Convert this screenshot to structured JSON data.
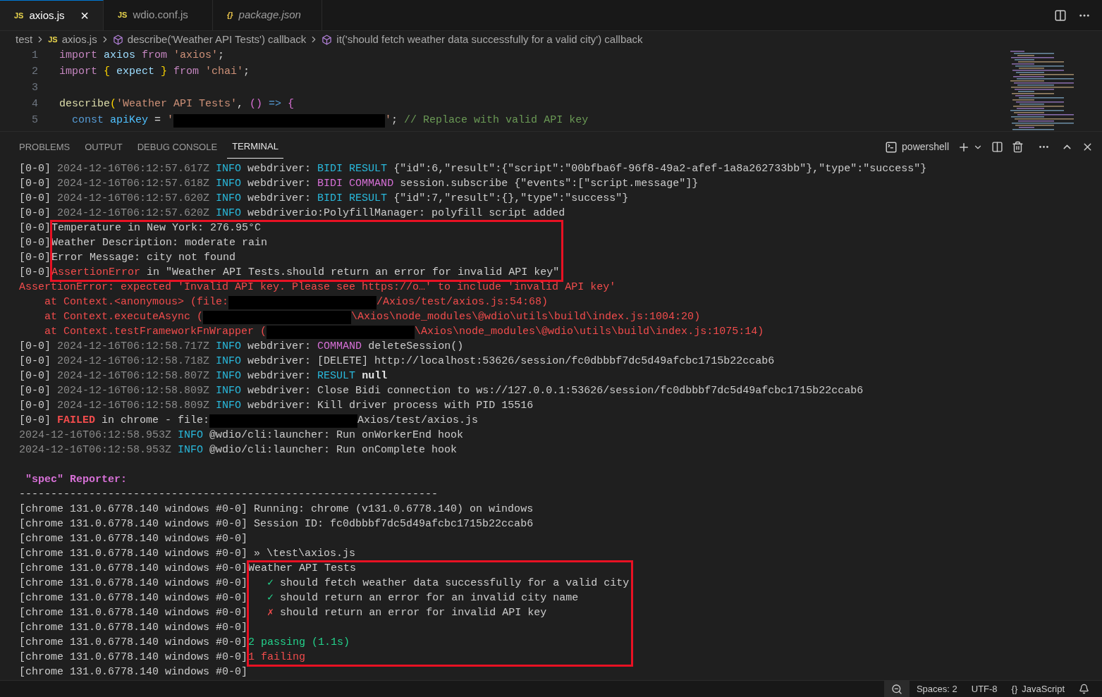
{
  "editor_tabs": [
    {
      "badge": "JS",
      "label": "axios.js",
      "selected": true,
      "preview": false,
      "close": "×"
    },
    {
      "badge": "JS",
      "label": "wdio.conf.js",
      "selected": false,
      "preview": false
    },
    {
      "badge": "{}",
      "label": "package.json",
      "selected": false,
      "preview": true
    }
  ],
  "breadcrumbs": [
    {
      "kind": "folder",
      "label": "test"
    },
    {
      "kind": "file",
      "badge": "JS",
      "label": "axios.js"
    },
    {
      "kind": "symbol",
      "label": "describe('Weather API Tests') callback"
    },
    {
      "kind": "symbol",
      "label": "it('should fetch weather data successfully for a valid city') callback"
    }
  ],
  "code_lines": [
    {
      "number": "1",
      "tokens": [
        {
          "kind": "keyword",
          "text": "import"
        },
        {
          "kind": "variable",
          "text": " axios"
        },
        {
          "kind": "keyword",
          "text": " from"
        },
        {
          "kind": "string",
          "text": " 'axios'"
        },
        {
          "kind": "plain",
          "text": ";"
        }
      ]
    },
    {
      "number": "2",
      "tokens": [
        {
          "kind": "keyword",
          "text": "import"
        },
        {
          "kind": "bracket",
          "text": " {"
        },
        {
          "kind": "variable",
          "text": " expect"
        },
        {
          "kind": "bracket",
          "text": " }"
        },
        {
          "kind": "keyword",
          "text": " from"
        },
        {
          "kind": "string",
          "text": " 'chai'"
        },
        {
          "kind": "plain",
          "text": ";"
        }
      ]
    },
    {
      "number": "3"
    },
    {
      "number": "4",
      "tokens": [
        {
          "kind": "function",
          "text": "describe"
        },
        {
          "kind": "bracket",
          "text": "("
        },
        {
          "kind": "string",
          "text": "'Weather API Tests'"
        },
        {
          "kind": "plain",
          "text": ","
        },
        {
          "kind": "paren",
          "text": " ()"
        },
        {
          "kind": "storage",
          "text": " =>"
        },
        {
          "kind": "paren",
          "text": " {"
        }
      ]
    },
    {
      "number": "5",
      "tokens": [
        {
          "kind": "storage",
          "text": "  const"
        },
        {
          "kind": "constant",
          "text": " apiKey"
        },
        {
          "kind": "plain",
          "text": " = "
        },
        {
          "kind": "string",
          "text": "'"
        },
        {
          "kind": "redacted"
        },
        {
          "kind": "string",
          "text": "'"
        },
        {
          "kind": "plain",
          "text": "; "
        },
        {
          "kind": "comment",
          "text": "// Replace with valid API key"
        }
      ]
    }
  ],
  "panel_tabs": [
    {
      "label": "PROBLEMS",
      "selected": false
    },
    {
      "label": "OUTPUT",
      "selected": false
    },
    {
      "label": "DEBUG CONSOLE",
      "selected": false
    },
    {
      "label": "TERMINAL",
      "selected": true
    }
  ],
  "terminal_name": "powershell",
  "terminal_blocks": [
    {
      "kind": "lines",
      "highlighted": false,
      "lines": [
        {
          "prefix": "[0-0]",
          "segments": [
            {
              "kind": "dim",
              "text": " 2024-12-16T06:12:57.617Z "
            },
            {
              "kind": "cyan",
              "text": "INFO"
            },
            {
              "kind": "plain",
              "text": " webdriver: "
            },
            {
              "kind": "cyan",
              "text": "BIDI RESULT"
            },
            {
              "kind": "plain",
              "text": " {\"id\":6,\"result\":{\"script\":\"00bfba6f-96f8-49a2-afef-1a8a262733bb\"},\"type\":\"success\"}"
            }
          ]
        },
        {
          "prefix": "[0-0]",
          "segments": [
            {
              "kind": "dim",
              "text": " 2024-12-16T06:12:57.618Z "
            },
            {
              "kind": "cyan",
              "text": "INFO"
            },
            {
              "kind": "plain",
              "text": " webdriver: "
            },
            {
              "kind": "magenta",
              "text": "BIDI COMMAND"
            },
            {
              "kind": "plain",
              "text": " session.subscribe {\"events\":[\"script.message\"]}"
            }
          ]
        },
        {
          "prefix": "[0-0]",
          "segments": [
            {
              "kind": "dim",
              "text": " 2024-12-16T06:12:57.620Z "
            },
            {
              "kind": "cyan",
              "text": "INFO"
            },
            {
              "kind": "plain",
              "text": " webdriver: "
            },
            {
              "kind": "cyan",
              "text": "BIDI RESULT"
            },
            {
              "kind": "plain",
              "text": " {\"id\":7,\"result\":{},\"type\":\"success\"}"
            }
          ]
        },
        {
          "prefix": "[0-0]",
          "segments": [
            {
              "kind": "dim",
              "text": " 2024-12-16T06:12:57.620Z "
            },
            {
              "kind": "cyan",
              "text": "INFO"
            },
            {
              "kind": "plain",
              "text": " webdriverio:PolyfillManager: polyfill script added"
            }
          ]
        }
      ]
    },
    {
      "kind": "lines",
      "highlighted": true,
      "lines": [
        {
          "prefix": "[0-0]",
          "segments": [
            {
              "kind": "plain",
              "text": "Temperature in New York: 276.95°C"
            }
          ]
        },
        {
          "prefix": "[0-0]",
          "segments": [
            {
              "kind": "plain",
              "text": "Weather Description: moderate rain"
            }
          ]
        },
        {
          "prefix": "[0-0]",
          "segments": [
            {
              "kind": "plain",
              "text": "Error Message: city not found"
            }
          ]
        },
        {
          "prefix": "[0-0]",
          "segments": [
            {
              "kind": "red",
              "text": "AssertionError"
            },
            {
              "kind": "plain",
              "text": " in \"Weather API Tests.should return an error for invalid API key\""
            }
          ]
        }
      ]
    },
    {
      "kind": "lines",
      "highlighted": false,
      "lines": [
        {
          "segments": [
            {
              "kind": "red",
              "text": "AssertionError: expected 'Invalid API key. Please see https://o…' to include 'invalid API key'"
            }
          ]
        },
        {
          "segments": [
            {
              "kind": "red",
              "text": "    at Context.<anonymous> (file:"
            },
            {
              "kind": "redacted"
            },
            {
              "kind": "red",
              "text": "/Axios/test/axios.js:54:68)"
            }
          ]
        },
        {
          "segments": [
            {
              "kind": "red",
              "text": "    at Context.executeAsync ("
            },
            {
              "kind": "redacted"
            },
            {
              "kind": "red",
              "text": "\\Axios\\node_modules\\@wdio\\utils\\build\\index.js:1004:20)"
            }
          ]
        },
        {
          "segments": [
            {
              "kind": "red",
              "text": "    at Context.testFrameworkFnWrapper ("
            },
            {
              "kind": "redacted"
            },
            {
              "kind": "red",
              "text": "\\Axios\\node_modules\\@wdio\\utils\\build\\index.js:1075:14)"
            }
          ]
        }
      ]
    },
    {
      "kind": "lines",
      "highlighted": false,
      "lines": [
        {
          "prefix": "[0-0]",
          "segments": [
            {
              "kind": "dim",
              "text": " 2024-12-16T06:12:58.717Z "
            },
            {
              "kind": "cyan",
              "text": "INFO"
            },
            {
              "kind": "plain",
              "text": " webdriver: "
            },
            {
              "kind": "magenta",
              "text": "COMMAND"
            },
            {
              "kind": "plain",
              "text": " deleteSession()"
            }
          ]
        },
        {
          "prefix": "[0-0]",
          "segments": [
            {
              "kind": "dim",
              "text": " 2024-12-16T06:12:58.718Z "
            },
            {
              "kind": "cyan",
              "text": "INFO"
            },
            {
              "kind": "plain",
              "text": " webdriver: [DELETE] http://localhost:53626/session/fc0dbbbf7dc5d49afcbc1715b22ccab6"
            }
          ]
        },
        {
          "prefix": "[0-0]",
          "segments": [
            {
              "kind": "dim",
              "text": " 2024-12-16T06:12:58.807Z "
            },
            {
              "kind": "cyan",
              "text": "INFO"
            },
            {
              "kind": "plain",
              "text": " webdriver: "
            },
            {
              "kind": "cyan",
              "text": "RESULT"
            },
            {
              "kind": "bold",
              "text": " null"
            }
          ]
        },
        {
          "prefix": "[0-0]",
          "segments": [
            {
              "kind": "dim",
              "text": " 2024-12-16T06:12:58.809Z "
            },
            {
              "kind": "cyan",
              "text": "INFO"
            },
            {
              "kind": "plain",
              "text": " webdriver: Close Bidi connection to ws://127.0.0.1:53626/session/fc0dbbbf7dc5d49afcbc1715b22ccab6"
            }
          ]
        },
        {
          "prefix": "[0-0]",
          "segments": [
            {
              "kind": "dim",
              "text": " 2024-12-16T06:12:58.809Z "
            },
            {
              "kind": "cyan",
              "text": "INFO"
            },
            {
              "kind": "plain",
              "text": " webdriver: Kill driver process with PID 15516"
            }
          ]
        },
        {
          "prefix": "[0-0]",
          "segments": [
            {
              "kind": "boldred",
              "text": " FAILED"
            },
            {
              "kind": "plain",
              "text": " in chrome - file:"
            },
            {
              "kind": "redacted"
            },
            {
              "kind": "plain",
              "text": "Axios/test/axios.js"
            }
          ]
        }
      ]
    },
    {
      "kind": "lines",
      "highlighted": false,
      "lines": [
        {
          "segments": [
            {
              "kind": "dim",
              "text": "2024-12-16T06:12:58.953Z "
            },
            {
              "kind": "cyan",
              "text": "INFO"
            },
            {
              "kind": "plain",
              "text": " @wdio/cli:launcher: Run onWorkerEnd hook"
            }
          ]
        },
        {
          "segments": [
            {
              "kind": "dim",
              "text": "2024-12-16T06:12:58.953Z "
            },
            {
              "kind": "cyan",
              "text": "INFO"
            },
            {
              "kind": "plain",
              "text": " @wdio/cli:launcher: Run onComplete hook"
            }
          ]
        }
      ]
    },
    {
      "kind": "blank"
    },
    {
      "kind": "lines",
      "highlighted": false,
      "lines": [
        {
          "segments": [
            {
              "kind": "boldmagenta",
              "text": " \"spec\" Reporter:"
            }
          ]
        },
        {
          "segments": [
            {
              "kind": "plain",
              "text": "------------------------------------------------------------------"
            }
          ]
        }
      ]
    },
    {
      "kind": "lines",
      "highlighted": false,
      "lines": [
        {
          "prefix": "[chrome 131.0.6778.140 windows #0-0]",
          "segments": [
            {
              "kind": "plain",
              "text": " Running: chrome (v131.0.6778.140) on windows"
            }
          ]
        },
        {
          "prefix": "[chrome 131.0.6778.140 windows #0-0]",
          "segments": [
            {
              "kind": "plain",
              "text": " Session ID: fc0dbbbf7dc5d49afcbc1715b22ccab6"
            }
          ]
        },
        {
          "prefix": "[chrome 131.0.6778.140 windows #0-0]"
        },
        {
          "prefix": "[chrome 131.0.6778.140 windows #0-0]",
          "segments": [
            {
              "kind": "plain",
              "text": " » \\test\\axios.js"
            }
          ]
        }
      ]
    },
    {
      "kind": "lines",
      "highlighted": true,
      "lines": [
        {
          "prefix": "[chrome 131.0.6778.140 windows #0-0]",
          "segments": [
            {
              "kind": "plain",
              "text": "Weather API Tests"
            }
          ]
        },
        {
          "prefix": "[chrome 131.0.6778.140 windows #0-0]",
          "segments": [
            {
              "kind": "green",
              "text": "   ✓"
            },
            {
              "kind": "plain",
              "text": " should fetch weather data successfully for a valid city"
            }
          ]
        },
        {
          "prefix": "[chrome 131.0.6778.140 windows #0-0]",
          "segments": [
            {
              "kind": "green",
              "text": "   ✓"
            },
            {
              "kind": "plain",
              "text": " should return an error for an invalid city name"
            }
          ]
        },
        {
          "prefix": "[chrome 131.0.6778.140 windows #0-0]",
          "segments": [
            {
              "kind": "red",
              "text": "   ✗"
            },
            {
              "kind": "plain",
              "text": " should return an error for invalid API key"
            }
          ]
        },
        {
          "prefix": "[chrome 131.0.6778.140 windows #0-0]"
        },
        {
          "prefix": "[chrome 131.0.6778.140 windows #0-0]",
          "segments": [
            {
              "kind": "green",
              "text": "2 passing (1.1s)"
            }
          ]
        },
        {
          "prefix": "[chrome 131.0.6778.140 windows #0-0]",
          "segments": [
            {
              "kind": "red",
              "text": "1 failing"
            }
          ]
        }
      ]
    },
    {
      "kind": "lines",
      "highlighted": false,
      "lines": [
        {
          "prefix": "[chrome 131.0.6778.140 windows #0-0]"
        }
      ]
    }
  ],
  "status_bar": [
    {
      "kind": "zoom"
    },
    {
      "kind": "text",
      "label": "Spaces: 2"
    },
    {
      "kind": "text",
      "label": "UTF-8"
    },
    {
      "kind": "language",
      "badge": "{}",
      "label": "JavaScript"
    },
    {
      "kind": "bell"
    }
  ]
}
